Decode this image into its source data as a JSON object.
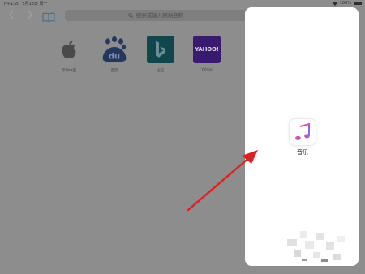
{
  "status_bar": {
    "time": "下午1:20",
    "date": "5月13日 周一",
    "wifi_icon": "wifi-icon",
    "battery_percent": "100%"
  },
  "toolbar": {
    "back_icon": "chevron-left-icon",
    "forward_icon": "chevron-right-icon",
    "bookmarks_icon": "book-icon",
    "search_placeholder": "搜索或输入网站名称"
  },
  "favorites": [
    {
      "label": "苹果中国",
      "icon": "apple-logo"
    },
    {
      "label": "百度",
      "icon": "baidu-logo"
    },
    {
      "label": "必应",
      "icon": "bing-logo"
    },
    {
      "label": "Yahoo",
      "icon": "yahoo-logo",
      "tile_text": "YAHOO!"
    }
  ],
  "slide_over": {
    "app_label": "音乐",
    "app_icon": "music-note-icon"
  },
  "colors": {
    "dim_background": "#8d8d8d",
    "panel": "#ffffff",
    "arrow": "#e0201e"
  }
}
